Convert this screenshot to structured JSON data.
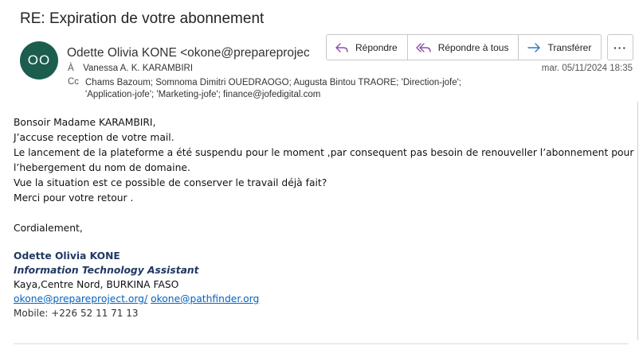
{
  "email": {
    "subject": "RE: Expiration de votre abonnement",
    "avatar_initials": "OO",
    "avatar_color": "#1b5e4f",
    "sender": "Odette Olivia KONE <okone@prepareproject.org>",
    "to_label": "À",
    "to": "Vanessa A. K. KARAMBIRI",
    "cc_label": "Cc",
    "cc": "Chams Bazoum; Somnoma Dimitri OUEDRAOGO; Augusta Bintou TRAORE; 'Direction-jofe'; 'Application-jofe'; 'Marketing-jofe'; finance@jofedigital.com",
    "date": "mar. 05/11/2024 18:35"
  },
  "actions": {
    "reply": "Répondre",
    "reply_all": "Répondre à tous",
    "forward": "Transférer",
    "more": "···"
  },
  "body": {
    "greeting": "Bonsoir Madame KARAMBIRI,",
    "line1": "J’accuse reception de votre mail.",
    "line2": "Le lancement de la plateforme a été suspendu pour le moment ,par consequent pas besoin de renouveller l’abonnement pour l’hebergement du nom de domaine.",
    "line3": "Vue la situation est ce possible de conserver  le  travail déjà fait?",
    "line4": "Merci pour votre retour  .",
    "closing": "Cordialement,"
  },
  "signature": {
    "name": "Odette Olivia KONE",
    "title": "Information Technology Assistant",
    "location": "Kaya,Centre Nord, BURKINA FASO",
    "email1": "okone@prepareproject.org/",
    "email2": "okone@pathfinder.org",
    "mobile": "Mobile: +226 52 11 71 13"
  }
}
